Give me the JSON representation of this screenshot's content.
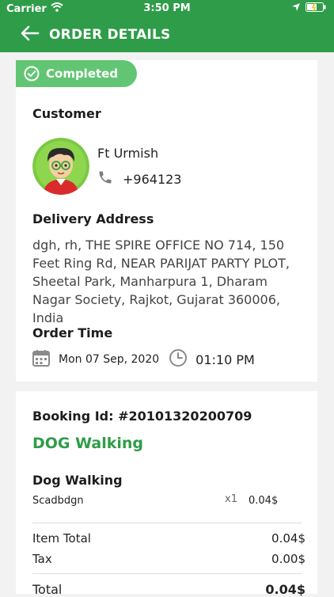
{
  "status_bar": {
    "carrier": "Carrier",
    "time": "3:50 PM"
  },
  "app_bar": {
    "title": "ORDER DETAILS"
  },
  "order": {
    "status": "Completed",
    "customer_label": "Customer",
    "customer_name": "Ft Urmish",
    "customer_phone": "+964123",
    "delivery_label": "Delivery Address",
    "delivery_address": "dgh, rh, THE SPIRE OFFICE NO 714, 150 Feet Ring Rd, NEAR PARIJAT PARTY PLOT, Sheetal Park, Manharpura 1, Dharam Nagar Society, Rajkot, Gujarat 360006, India",
    "order_time_label": "Order Time",
    "order_date": "Mon 07 Sep, 2020",
    "order_time": "01:10 PM"
  },
  "booking": {
    "id_text": "Booking Id: #20101320200709",
    "service_title": "DOG Walking",
    "item_group": "Dog Walking",
    "item_name": "Scadbdgn",
    "item_qty": "x1",
    "item_price": "0.04$",
    "item_total_label": "Item Total",
    "item_total_value": "0.04$",
    "tax_label": "Tax",
    "tax_value": "0.00$",
    "total_label": "Total",
    "total_value": "0.04$"
  },
  "colors": {
    "primary": "#2e9c48",
    "badge": "#62c573"
  },
  "icons": [
    "wifi-icon",
    "location-arrow-icon",
    "battery-icon",
    "back-arrow-icon",
    "check-circle-icon",
    "phone-icon",
    "calendar-icon",
    "clock-icon"
  ]
}
